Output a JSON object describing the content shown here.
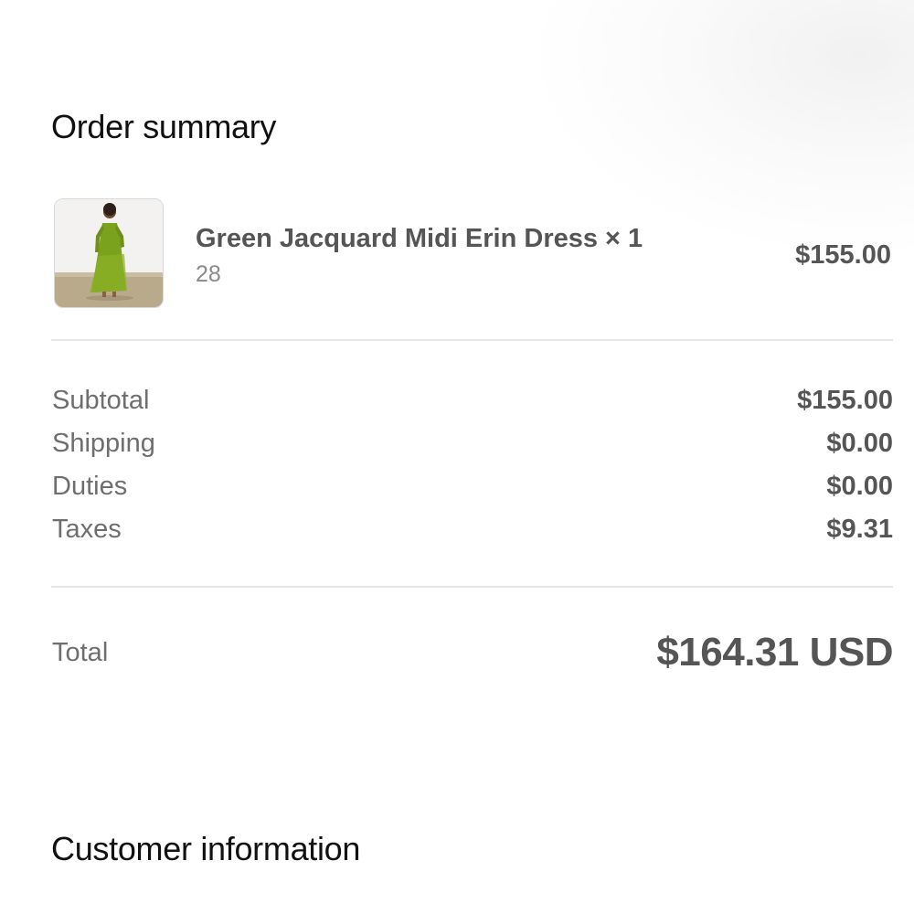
{
  "order_summary": {
    "title": "Order summary",
    "item": {
      "name": "Green Jacquard Midi Erin Dress × 1",
      "variant": "28",
      "price": "$155.00",
      "image_icon": "product-photo-green-dress"
    },
    "costs": {
      "subtotal_label": "Subtotal",
      "subtotal_value": "$155.00",
      "shipping_label": "Shipping",
      "shipping_value": "$0.00",
      "duties_label": "Duties",
      "duties_value": "$0.00",
      "taxes_label": "Taxes",
      "taxes_value": "$9.31"
    },
    "total": {
      "label": "Total",
      "value": "$164.31 USD"
    }
  },
  "customer_information": {
    "title": "Customer information"
  },
  "colors": {
    "heading": "#111111",
    "value_text": "#555555",
    "label_text": "#6e6e6e",
    "muted_text": "#8a8a8a",
    "divider": "#e6e6e6",
    "dress_green": "#7aa21c"
  }
}
